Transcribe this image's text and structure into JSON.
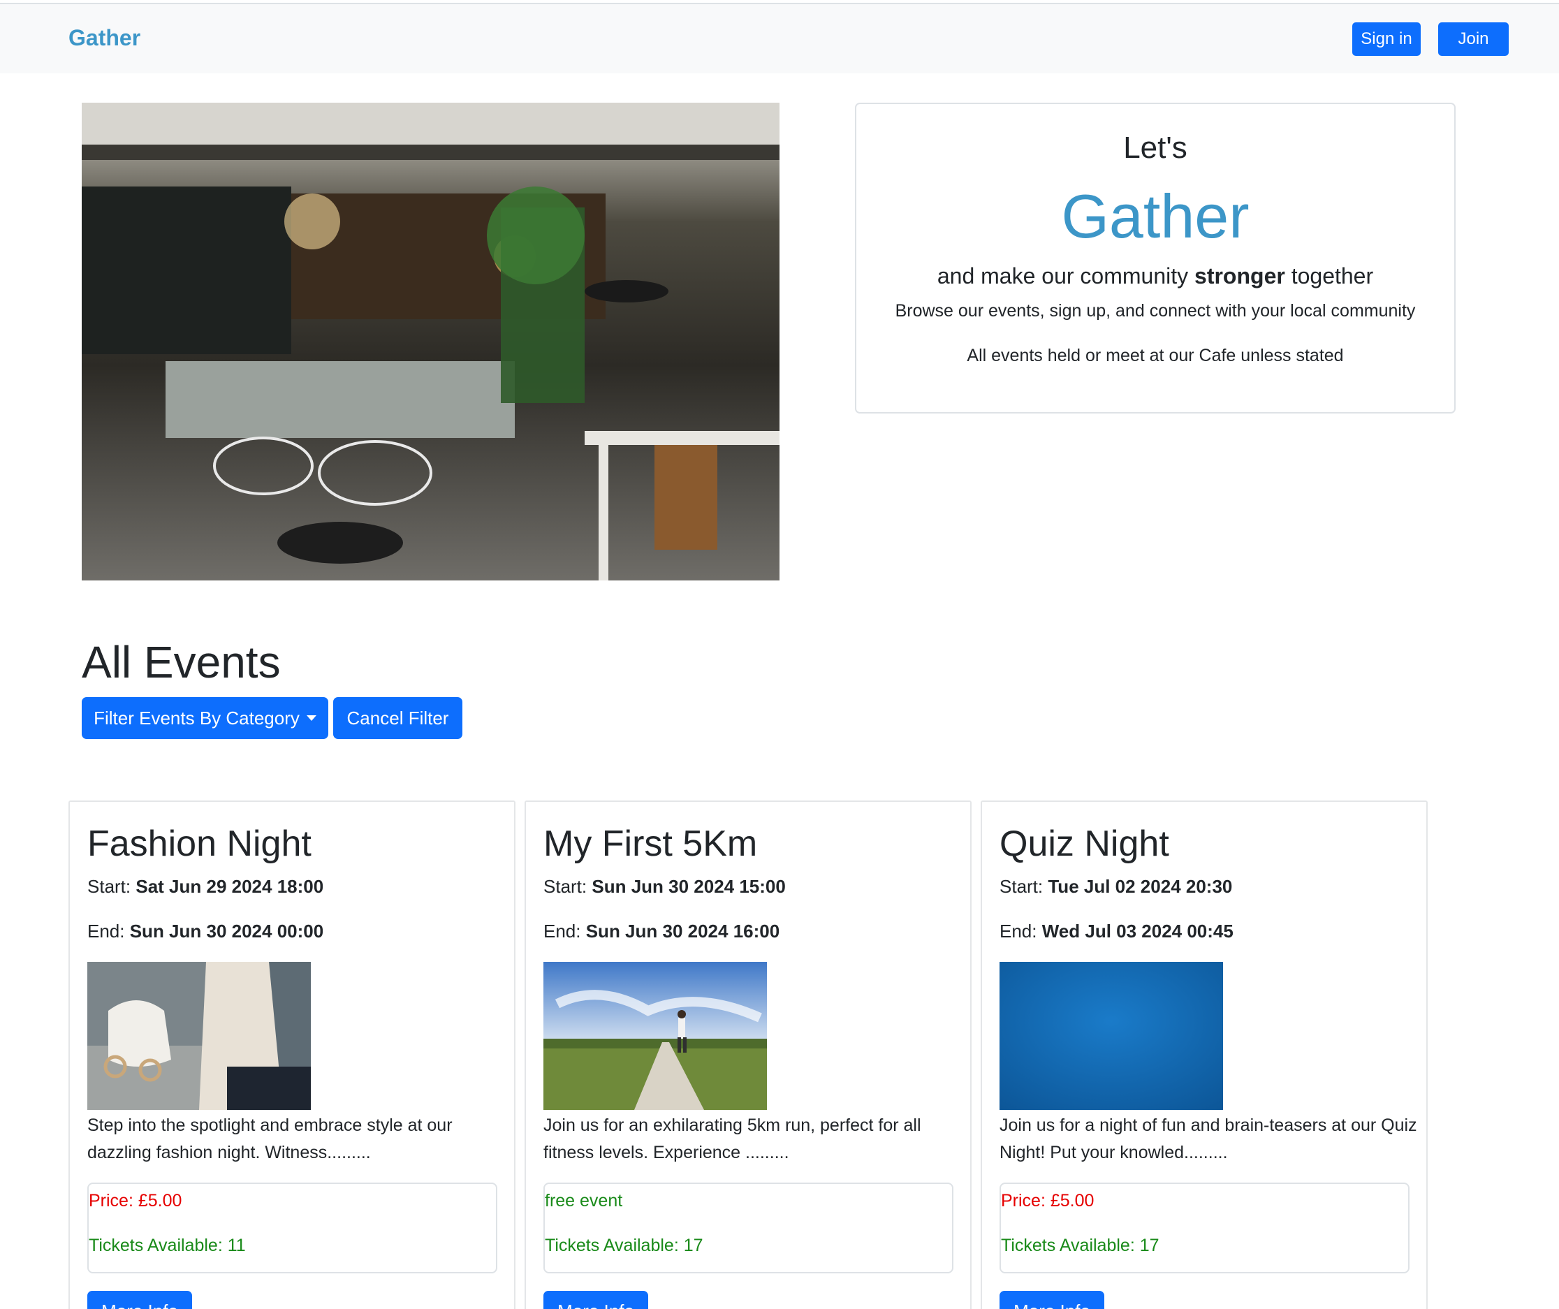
{
  "navbar": {
    "brand": "Gather",
    "signin_label": "Sign in",
    "join_label": "Join"
  },
  "hero": {
    "lets": "Let's",
    "gather": "Gather",
    "tagline_pre": "and make our community ",
    "tagline_bold": "stronger",
    "tagline_post": " together",
    "browse": "Browse our events, sign up, and connect with your local community",
    "held": "All events held or meet at our Cafe unless stated"
  },
  "events": {
    "heading": "All Events",
    "filter_label": "Filter Events By Category",
    "cancel_label": "Cancel Filter",
    "start_label": "Start: ",
    "end_label": "End: ",
    "tickets_label": "Tickets Available: ",
    "more_label": "More Info",
    "cards": [
      {
        "title": "Fashion Night",
        "start": "Sat Jun 29 2024 18:00",
        "end": "Sun Jun 30 2024 00:00",
        "description": "Step into the spotlight and embrace style at our dazzling fashion night. Witness.........",
        "price": "Price: £5.00",
        "price_color": "#e60000",
        "tickets": "Tickets Available: 11"
      },
      {
        "title": "My First 5Km",
        "start": "Sun Jun 30 2024 15:00",
        "end": "Sun Jun 30 2024 16:00",
        "description": "Join us for an exhilarating 5km run, perfect for all fitness levels. Experience .........",
        "price": "free event",
        "price_color": "#198a19",
        "tickets": "Tickets Available: 17"
      },
      {
        "title": "Quiz Night",
        "start": "Tue Jul 02 2024 20:30",
        "end": "Wed Jul 03 2024 00:45",
        "description": "Join us for a night of fun and brain-teasers at our Quiz Night! Put your knowled.........",
        "price": "Price: £5.00",
        "price_color": "#e60000",
        "tickets": "Tickets Available: 17"
      }
    ]
  },
  "colors": {
    "brand": "#3c96c8",
    "primary_button": "#0d6efd",
    "price_red": "#e60000",
    "ticket_green": "#198a19"
  }
}
